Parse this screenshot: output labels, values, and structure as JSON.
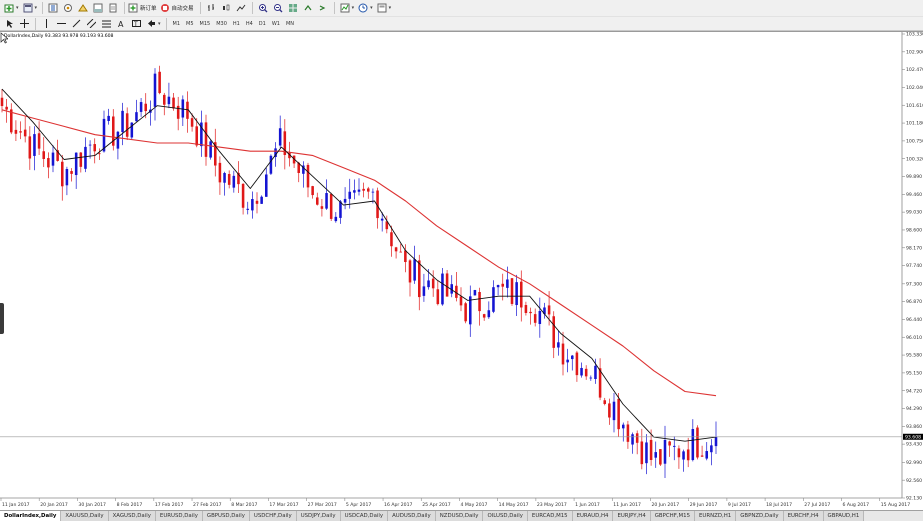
{
  "toolbar": {
    "new_order_label": "新订单",
    "auto_trading_label": "自动交易"
  },
  "timeframes": [
    "M1",
    "M5",
    "M15",
    "M30",
    "H1",
    "H4",
    "D1",
    "W1",
    "MN"
  ],
  "chart": {
    "symbol_label": "DollarIndex,Daily  93.383 93.978 93.193 93.608",
    "current_price": "93.608",
    "price_ticks": [
      "103.330",
      "102.900",
      "102.470",
      "102.040",
      "101.610",
      "101.180",
      "100.750",
      "100.320",
      "99.890",
      "99.460",
      "99.030",
      "98.600",
      "98.170",
      "97.740",
      "97.300",
      "96.870",
      "96.440",
      "96.010",
      "95.580",
      "95.150",
      "94.720",
      "94.290",
      "93.860",
      "93.430",
      "92.990",
      "92.560",
      "92.130"
    ],
    "date_ticks": [
      "11 Jan 2017",
      "20 Jan 2017",
      "30 Jan 2017",
      "8 Feb 2017",
      "17 Feb 2017",
      "27 Feb 2017",
      "8 Mar 2017",
      "17 Mar 2017",
      "27 Mar 2017",
      "5 Apr 2017",
      "16 Apr 2017",
      "25 Apr 2017",
      "4 May 2017",
      "14 May 2017",
      "23 May 2017",
      "1 Jun 2017",
      "11 Jun 2017",
      "20 Jun 2017",
      "29 Jun 2017",
      "9 Jul 2017",
      "18 Jul 2017",
      "27 Jul 2017",
      "6 Aug 2017",
      "15 Aug 2017"
    ],
    "colors": {
      "bull": "#1414d2",
      "bear": "#e01818",
      "ma_fast": "#111111",
      "ma_slow": "#dd3333",
      "price_line": "#9a9a9a"
    }
  },
  "chart_data": {
    "type": "candlestick",
    "timeframe": "Daily",
    "price_range": [
      92.13,
      103.33
    ],
    "current_price": 93.608,
    "ohlc_summary": [
      [
        "11 Jan 2017",
        101.8,
        102.2,
        101.3,
        101.6
      ],
      [
        "20 Jan 2017",
        101.2,
        101.4,
        100.2,
        100.6
      ],
      [
        "30 Jan 2017",
        99.8,
        100.3,
        99.5,
        100.0
      ],
      [
        "8 Feb 2017",
        100.2,
        100.9,
        100.0,
        100.8
      ],
      [
        "17 Feb 2017",
        101.0,
        101.3,
        100.6,
        101.1
      ],
      [
        "27 Feb 2017",
        101.5,
        102.3,
        101.2,
        102.0
      ],
      [
        "8 Mar 2017",
        101.9,
        102.2,
        101.3,
        101.4
      ],
      [
        "17 Mar 2017",
        100.4,
        100.6,
        99.8,
        100.0
      ],
      [
        "27 Mar 2017",
        99.5,
        99.7,
        99.0,
        99.3
      ],
      [
        "5 Apr 2017",
        100.4,
        101.0,
        100.2,
        100.7
      ],
      [
        "16 Apr 2017",
        100.0,
        100.2,
        99.3,
        99.5
      ],
      [
        "25 Apr 2017",
        99.0,
        99.2,
        98.9,
        99.0
      ],
      [
        "4 May 2017",
        99.4,
        99.6,
        99.0,
        99.5
      ],
      [
        "14 May 2017",
        98.2,
        98.4,
        97.3,
        97.6
      ],
      [
        "23 May 2017",
        97.3,
        97.5,
        96.8,
        97.2
      ],
      [
        "1 Jun 2017",
        96.9,
        97.1,
        96.5,
        96.7
      ],
      [
        "11 Jun 2017",
        97.0,
        97.2,
        96.6,
        97.1
      ],
      [
        "20 Jun 2017",
        97.1,
        97.3,
        96.8,
        97.0
      ],
      [
        "29 Jun 2017",
        96.0,
        96.2,
        95.6,
        95.8
      ],
      [
        "9 Jul 2017",
        95.9,
        96.0,
        95.0,
        95.2
      ],
      [
        "18 Jul 2017",
        94.4,
        94.6,
        93.8,
        94.0
      ],
      [
        "27 Jul 2017",
        93.5,
        93.8,
        92.7,
        93.0
      ],
      [
        "6 Aug 2017",
        93.3,
        93.6,
        92.9,
        93.4
      ],
      [
        "15 Aug 2017",
        93.4,
        93.98,
        93.19,
        93.608
      ]
    ],
    "series": [
      {
        "name": "",
        "values": [
          102.0,
          101.2,
          100.3,
          100.4,
          101.0,
          101.6,
          101.5,
          100.5,
          99.6,
          100.6,
          99.9,
          99.2,
          99.3,
          98.1,
          97.4,
          96.9,
          97.0,
          97.0,
          96.1,
          95.5,
          94.4,
          93.6,
          93.5,
          93.6
        ]
      },
      {
        "name": "",
        "values": [
          101.5,
          101.3,
          101.1,
          100.9,
          100.8,
          100.7,
          100.7,
          100.6,
          100.5,
          100.5,
          100.4,
          100.1,
          99.8,
          99.3,
          98.7,
          98.2,
          97.7,
          97.3,
          96.8,
          96.3,
          95.8,
          95.2,
          94.7,
          94.6
        ]
      }
    ]
  },
  "tabs": [
    "DollarIndex,Daily",
    "XAUUSD,Daily",
    "XAGUSD,Daily",
    "EURUSD,Daily",
    "GBPUSD,Daily",
    "USDCHF,Daily",
    "USDJPY,Daily",
    "USDCAD,Daily",
    "AUDUSD,Daily",
    "NZDUSD,Daily",
    "OILUSD,Daily",
    "EURCAD,M15",
    "EURAUD,H4",
    "EURJPY,H4",
    "GBPCHF,M15",
    "EURNZD,H1",
    "GBPNZD,Daily",
    "EURCHF,H4",
    "GBPAUD,H1"
  ],
  "active_tab": 0
}
